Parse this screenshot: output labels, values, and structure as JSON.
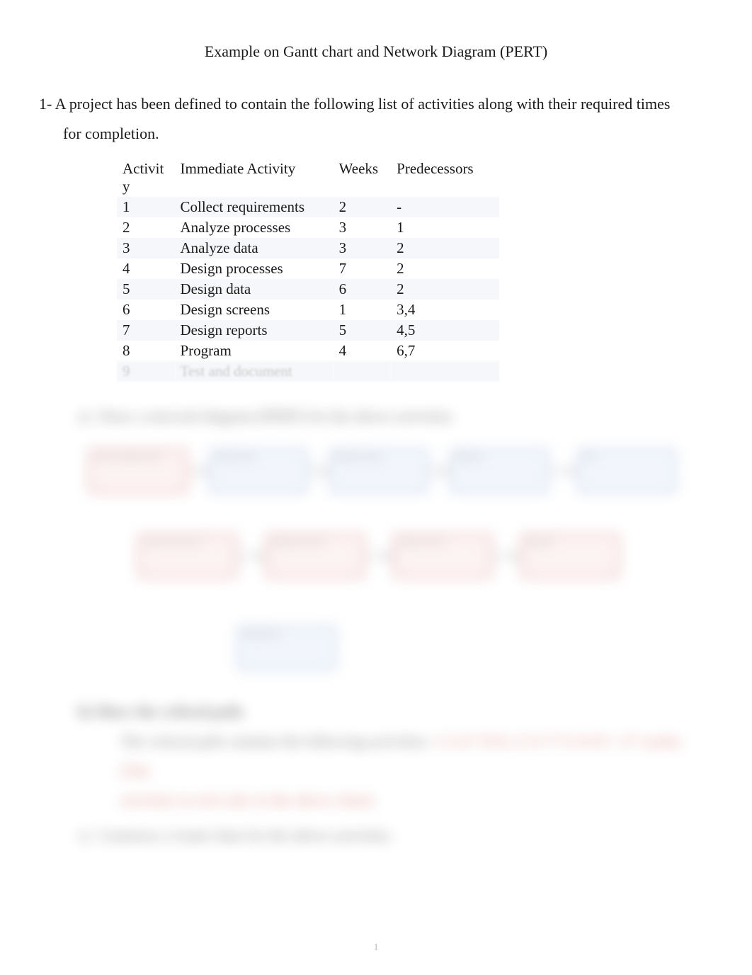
{
  "title": "Example on Gantt chart and Network Diagram (PERT)",
  "question_num": "1-",
  "question_line1": "A project has been defined to contain the following list of activities along with their required times",
  "question_line2": "for completion.",
  "table": {
    "headers": {
      "activity_l1": "Activit",
      "activity_l2": "y",
      "immediate": "Immediate Activity",
      "weeks": "Weeks",
      "pred": "Predecessors"
    },
    "rows": [
      {
        "n": "1",
        "act": "Collect requirements",
        "w": "2",
        "p": "-"
      },
      {
        "n": "2",
        "act": "Analyze processes",
        "w": "3",
        "p": "1"
      },
      {
        "n": "3",
        "act": "Analyze data",
        "w": "3",
        "p": "2"
      },
      {
        "n": "4",
        "act": "Design processes",
        "w": "7",
        "p": "2"
      },
      {
        "n": "5",
        "act": "Design data",
        "w": "6",
        "p": "2"
      },
      {
        "n": "6",
        "act": "Design screens",
        "w": "1",
        "p": "3,4"
      },
      {
        "n": "7",
        "act": "Design reports",
        "w": "5",
        "p": "4,5"
      },
      {
        "n": "8",
        "act": "Program",
        "w": "4",
        "p": "6,7"
      },
      {
        "n": "9",
        "act": "Test and document",
        "w": "",
        "p": ""
      }
    ]
  },
  "sub_a": {
    "label": "a)",
    "text": "Draw a network diagram (PERT) for the above activities."
  },
  "diagram_nodes": {
    "n1": "Collect Requirements",
    "n2": "Analyze processes",
    "n3": "Analyze data",
    "n4": "Design processes",
    "n5": "Design data",
    "n6": "Design screens",
    "n7": "Design reports",
    "n8": "Program",
    "n9": "Test"
  },
  "sub_b": {
    "label": "b)",
    "heading": "Show the critical path.",
    "line1a": "The critical path contains the following activities: ",
    "line1b": "1-2-4-7-8-9, 2+3+7+5+4+8 = 27 weeks. (The",
    "line2": "activities in red color in the above chart)."
  },
  "sub_c": {
    "label": "c)",
    "text": "Construct a Gantt chart for the above activities."
  },
  "page_number": "1"
}
